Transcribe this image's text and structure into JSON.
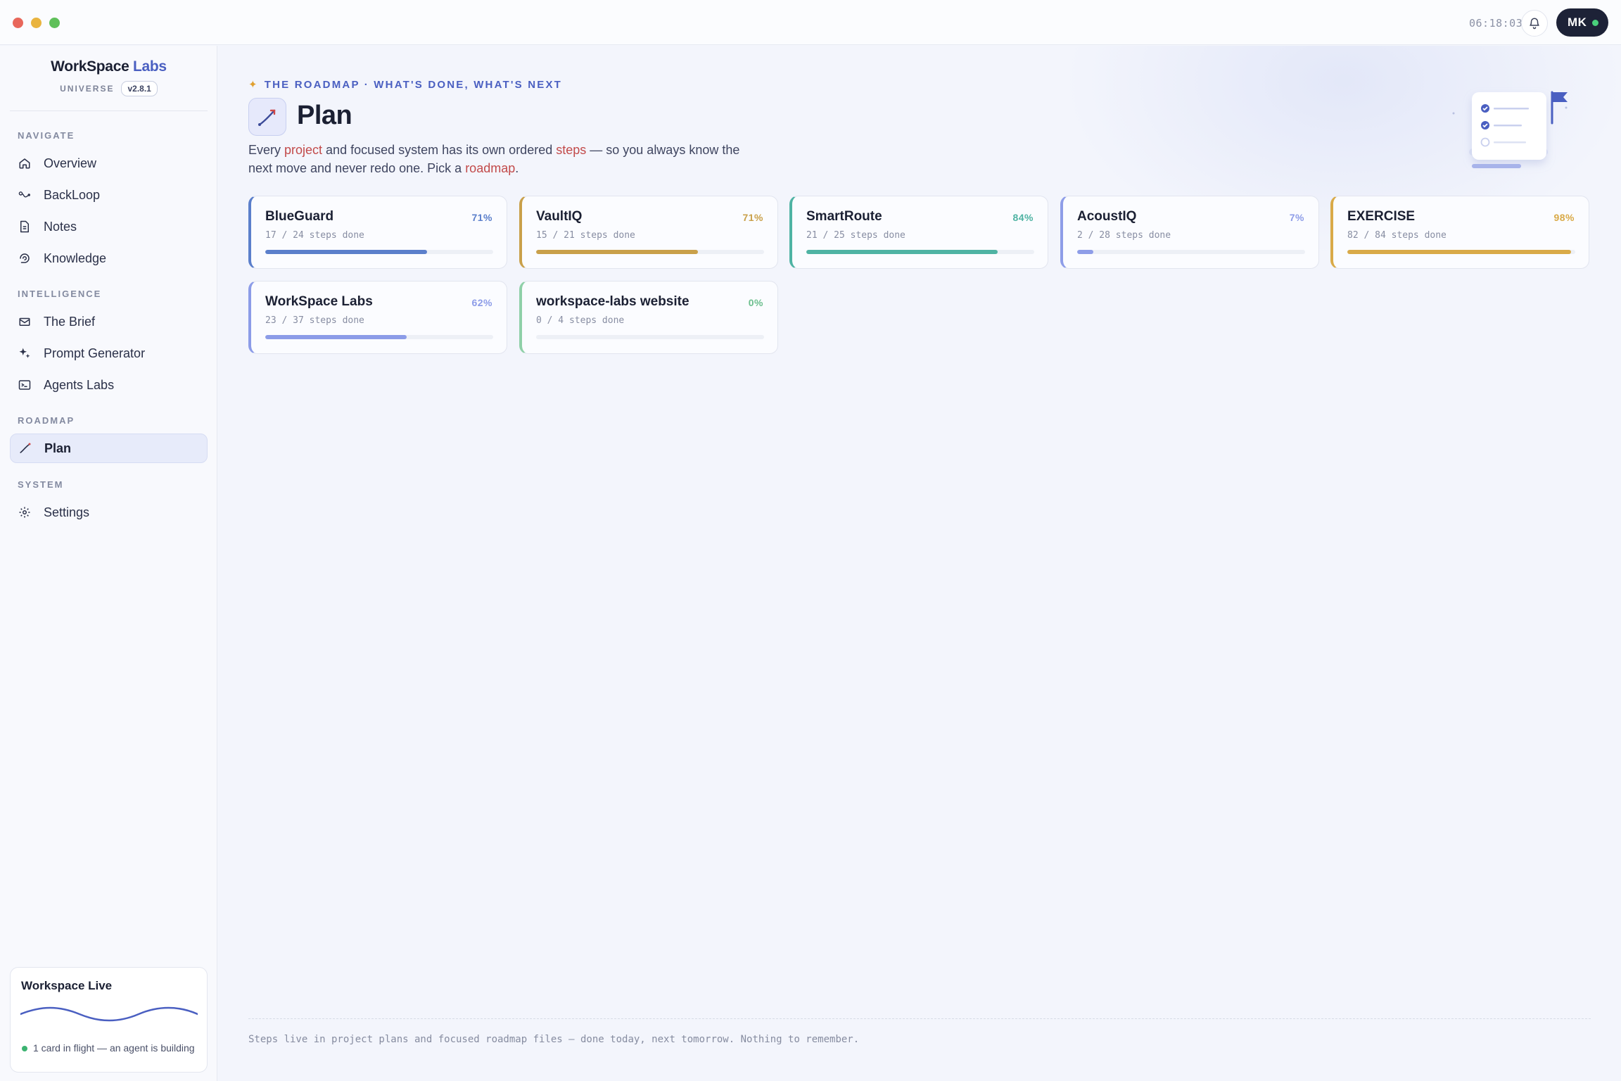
{
  "window": {
    "clock": "06:18:03",
    "avatar_initials": "MK"
  },
  "sidebar": {
    "brand_main": "WorkSpace",
    "brand_accent": "Labs",
    "brand_sub": "UNIVERSE",
    "version": "v2.8.1",
    "sections": {
      "navigate": "NAVIGATE",
      "intelligence": "INTELLIGENCE",
      "roadmap": "ROADMAP",
      "system": "SYSTEM"
    },
    "items": [
      {
        "label": "Overview",
        "icon": "home-icon"
      },
      {
        "label": "BackLoop",
        "icon": "loop-icon"
      },
      {
        "label": "Notes",
        "icon": "note-icon"
      },
      {
        "label": "Knowledge",
        "icon": "brain-icon"
      },
      {
        "label": "The Brief",
        "icon": "mail-icon"
      },
      {
        "label": "Prompt Generator",
        "icon": "sparkle-icon"
      },
      {
        "label": "Agents Labs",
        "icon": "terminal-icon"
      },
      {
        "label": "Plan",
        "icon": "trend-icon",
        "active": true
      },
      {
        "label": "Settings",
        "icon": "gear-icon"
      }
    ],
    "live": {
      "title": "Workspace Live",
      "status": "1 card in flight — an agent is building"
    }
  },
  "main": {
    "eyebrow": "THE ROADMAP · WHAT'S DONE, WHAT'S NEXT",
    "title": "Plan",
    "description": {
      "p1": "Every ",
      "h1": "project",
      "p2": " and focused system has its own ordered ",
      "h2": "steps",
      "p3": " — so you always know the next move and never redo one. Pick a ",
      "h3": "roadmap",
      "p4": "."
    },
    "cards": [
      {
        "name": "BlueGuard",
        "pct": "71%",
        "steps": "17 / 24 steps done",
        "progress": 0.71,
        "color": "#5b7fcb"
      },
      {
        "name": "VaultIQ",
        "pct": "71%",
        "steps": "15 / 21 steps done",
        "progress": 0.71,
        "color": "#c9a04a"
      },
      {
        "name": "SmartRoute",
        "pct": "84%",
        "steps": "21 / 25 steps done",
        "progress": 0.84,
        "color": "#4fb3a3"
      },
      {
        "name": "AcoustIQ",
        "pct": "7%",
        "steps": "2 / 28 steps done",
        "progress": 0.07,
        "color": "#8e9de8"
      },
      {
        "name": "EXERCISE",
        "pct": "98%",
        "steps": "82 / 84 steps done",
        "progress": 0.98,
        "color": "#d9aa48"
      },
      {
        "name": "WorkSpace Labs",
        "pct": "62%",
        "steps": "23 / 37 steps done",
        "progress": 0.62,
        "color": "#8c9ce8"
      },
      {
        "name": "workspace-labs website",
        "pct": "0%",
        "steps": "0 / 4 steps done",
        "progress": 0.0,
        "color": "#8fd0a8"
      }
    ],
    "footer": "Steps live in project plans and focused roadmap files — done today, next tomorrow. Nothing to remember."
  }
}
